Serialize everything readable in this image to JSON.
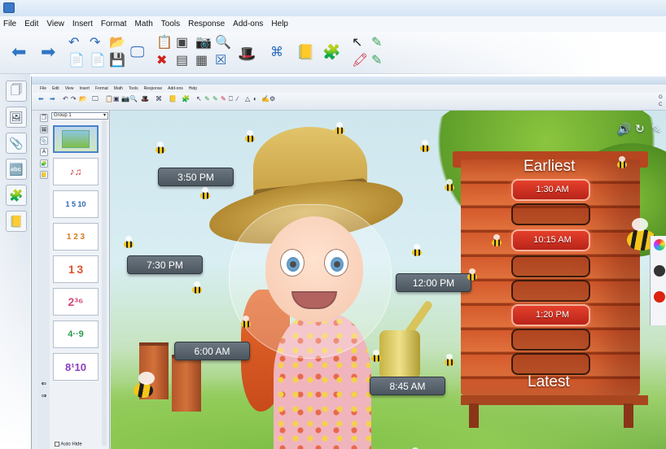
{
  "outer": {
    "menu": [
      "File",
      "Edit",
      "View",
      "Insert",
      "Format",
      "Math",
      "Tools",
      "Response",
      "Add-ons",
      "Help"
    ]
  },
  "inner": {
    "menu": [
      "File",
      "Edit",
      "View",
      "Insert",
      "Format",
      "Math",
      "Tools",
      "Response",
      "Add-ons",
      "Help"
    ],
    "group_select": "Group 1",
    "autohide_label": "Auto Hide",
    "right_letters": [
      "G",
      "C"
    ]
  },
  "sidebar": {
    "thumbnails": [
      "hive-activity",
      "musical-notes",
      "number-line",
      "counting-grid",
      "123-numbers",
      "number-2-6",
      "number-4-9",
      "number-8-10"
    ],
    "thumb_text": [
      "",
      "♪♫",
      "1 5 10",
      "1 2 3",
      "1 3",
      "2³⁶",
      "4··9",
      "8¹10"
    ]
  },
  "activity": {
    "header_top": "Earliest",
    "header_bottom": "Latest",
    "slots": [
      "1:30 AM",
      "",
      "10:15 AM",
      "",
      "",
      "1:20 PM",
      "",
      ""
    ],
    "cards": [
      "3:50 PM",
      "7:30 PM",
      "12:00 PM",
      "6:00 AM",
      "8:45 AM"
    ]
  },
  "colors": {
    "slot_filled": "#d8301f",
    "card": "#56606a",
    "hive": "#d45a2c"
  }
}
